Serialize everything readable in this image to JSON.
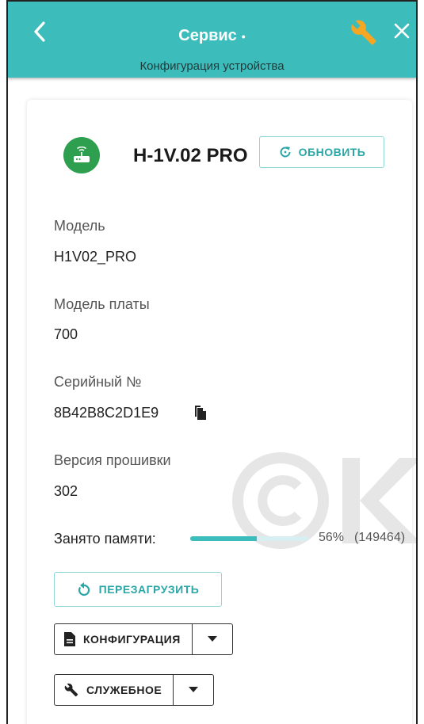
{
  "header": {
    "title": "Сервис",
    "title_dot": "•",
    "subtitle": "Конфигурация устройства",
    "color": "#3dbcbc"
  },
  "device": {
    "name": "H-1V.02 PRO",
    "icon": "router-icon",
    "icon_color": "#2e9e4f",
    "refresh_label": "ОБНОВИТЬ"
  },
  "properties": {
    "model_label": "Модель",
    "model_value": "H1V02_PRO",
    "board_label": "Модель платы",
    "board_value": "700",
    "serial_label": "Серийный №",
    "serial_value": "8B42B8C2D1E9",
    "firmware_label": "Версия прошивки",
    "firmware_value": "302"
  },
  "memory": {
    "label": "Занято памяти:",
    "percent": 56,
    "percent_text": "56%",
    "bytes_text": "(149464)"
  },
  "actions": {
    "reboot_label": "ПЕРЕЗАГРУЗИТЬ",
    "config_label": "КОНФИГУРАЦИЯ",
    "service_label": "СЛУЖЕБНОЕ"
  },
  "accent_color": "#2aa6a6"
}
